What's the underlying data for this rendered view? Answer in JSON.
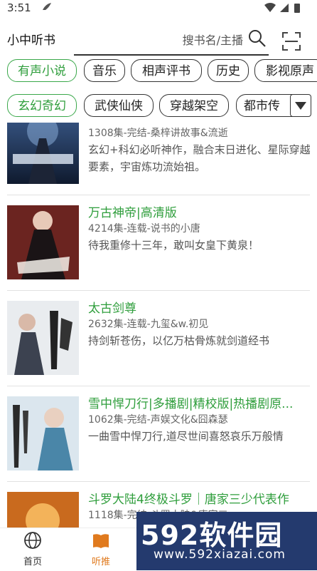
{
  "status_bar": {
    "time": "3:51"
  },
  "header": {
    "app_title": "小中听书",
    "search_placeholder": "搜书名/主播"
  },
  "category_tabs": [
    "有声小说",
    "音乐",
    "相声评书",
    "历史",
    "影视原声"
  ],
  "genre_tabs": [
    "玄幻奇幻",
    "武侠仙侠",
    "穿越架空",
    "都市传"
  ],
  "books": [
    {
      "title": "",
      "meta": "1308集-完结-桑梓讲故事&流逝",
      "desc": "玄幻+科幻必听神作，融合末日进化、星际穿越要素，宇宙炼功流始祖。"
    },
    {
      "title": "万古神帝|高清版",
      "meta": "4214集-连载-说书的小唐",
      "desc": "待我重修十三年，敢叫女皇下黄泉！"
    },
    {
      "title": "太古剑尊",
      "meta": "2632集-连载-九玺&w.初见",
      "desc": "持剑斩苍伤，以亿万枯骨炼就剑道经书"
    },
    {
      "title": "雪中悍刀行|多播剧|精校版|热播剧原...",
      "meta": "1062集-完结-声娱文化&囧森瑟",
      "desc": "一曲雪中悍刀行,道尽世间喜怒哀乐万般情"
    },
    {
      "title": "斗罗大陆4终极斗罗｜唐家三少代表作",
      "meta": "1118集-完结-斗罗大陆&唐家三",
      "desc": ""
    }
  ],
  "bottom_nav": [
    {
      "label": "首页",
      "icon": "globe-icon"
    },
    {
      "label": "听推",
      "icon": "book-icon"
    }
  ],
  "watermark": {
    "main": "592软件园",
    "url": "www.592xiazai.com"
  },
  "colors": {
    "accent_green": "#2f9e3c",
    "active_orange": "#e07a1e"
  }
}
